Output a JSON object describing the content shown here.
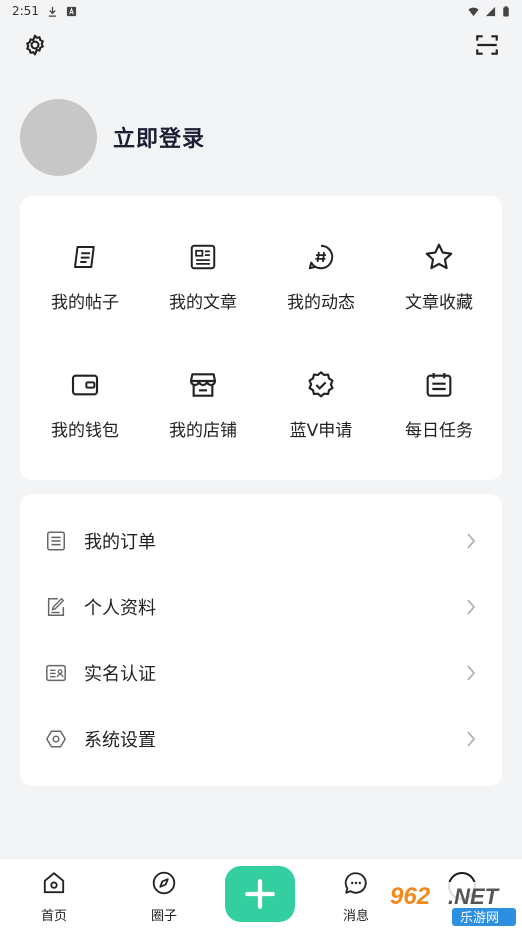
{
  "status_bar": {
    "time": "2:51"
  },
  "profile": {
    "login_text": "立即登录"
  },
  "grid": {
    "items": [
      {
        "label": "我的帖子",
        "icon": "post-icon"
      },
      {
        "label": "我的文章",
        "icon": "article-icon"
      },
      {
        "label": "我的动态",
        "icon": "hashtag-icon"
      },
      {
        "label": "文章收藏",
        "icon": "star-icon"
      },
      {
        "label": "我的钱包",
        "icon": "wallet-icon"
      },
      {
        "label": "我的店铺",
        "icon": "store-icon"
      },
      {
        "label": "蓝V申请",
        "icon": "verified-badge-icon"
      },
      {
        "label": "每日任务",
        "icon": "calendar-icon"
      }
    ]
  },
  "list": {
    "items": [
      {
        "label": "我的订单",
        "icon": "order-list-icon"
      },
      {
        "label": "个人资料",
        "icon": "edit-profile-icon"
      },
      {
        "label": "实名认证",
        "icon": "id-card-icon"
      },
      {
        "label": "系统设置",
        "icon": "hexagon-settings-icon"
      }
    ]
  },
  "bottom_nav": {
    "items": [
      {
        "label": "首页",
        "icon": "home-icon"
      },
      {
        "label": "圈子",
        "icon": "compass-icon"
      },
      {
        "label": "消息",
        "icon": "chat-icon"
      }
    ]
  },
  "watermark": {
    "text": "962.NET",
    "subtext": "乐游网"
  },
  "colors": {
    "accent": "#34cfa1",
    "avatar": "#c7c7c7",
    "background": "#f3f4f6"
  }
}
